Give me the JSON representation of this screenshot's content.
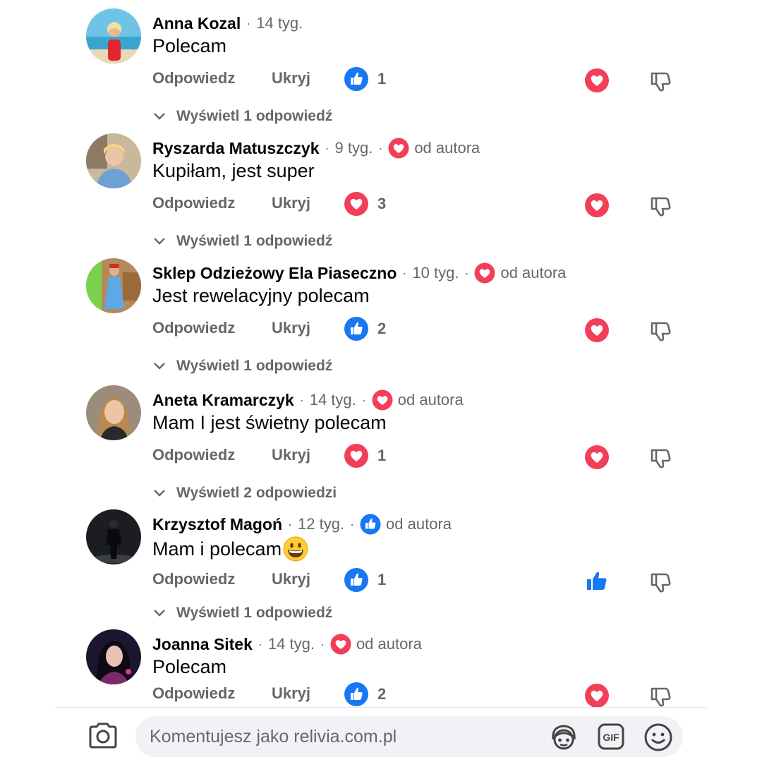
{
  "colors": {
    "like_blue": "#1877f2",
    "love_red": "#f33e58",
    "secondary_text": "#65676b",
    "input_bg": "#f0f2f5"
  },
  "comments": [
    {
      "author": "Anna Kozal",
      "time": "14 tyg.",
      "author_badge": null,
      "text": "Polecam",
      "reply_label": "Odpowiedz",
      "hide_label": "Ukryj",
      "reaction_type": "like",
      "reaction_count": "1",
      "my_reaction": "love",
      "replies_label": "Wyświetl 1 odpowiedź"
    },
    {
      "author": "Ryszarda Matuszczyk",
      "time": "9 tyg.",
      "author_badge": "love",
      "author_badge_label": "od autora",
      "text": "Kupiłam, jest super",
      "reply_label": "Odpowiedz",
      "hide_label": "Ukryj",
      "reaction_type": "love",
      "reaction_count": "3",
      "my_reaction": "love",
      "replies_label": "Wyświetl 1 odpowiedź"
    },
    {
      "author": "Sklep Odzieżowy Ela Piaseczno",
      "time": "10 tyg.",
      "author_badge": "love",
      "author_badge_label": "od autora",
      "text": "Jest rewelacyjny polecam",
      "reply_label": "Odpowiedz",
      "hide_label": "Ukryj",
      "reaction_type": "like",
      "reaction_count": "2",
      "my_reaction": "love",
      "replies_label": "Wyświetl 1 odpowiedź"
    },
    {
      "author": "Aneta Kramarczyk",
      "time": "14 tyg.",
      "author_badge": "love",
      "author_badge_label": "od autora",
      "text": "Mam I jest świetny polecam",
      "reply_label": "Odpowiedz",
      "hide_label": "Ukryj",
      "reaction_type": "love",
      "reaction_count": "1",
      "my_reaction": "love",
      "replies_label": "Wyświetl 2 odpowiedzi"
    },
    {
      "author": "Krzysztof Magoń",
      "time": "12 tyg.",
      "author_badge": "like",
      "author_badge_label": "od autora",
      "text": "Mam i polecam",
      "text_emoji": "grinning-face",
      "reply_label": "Odpowiedz",
      "hide_label": "Ukryj",
      "reaction_type": "like",
      "reaction_count": "1",
      "my_reaction": "like",
      "replies_label": "Wyświetl 1 odpowiedź"
    },
    {
      "author": "Joanna Sitek",
      "time": "14 tyg.",
      "author_badge": "love",
      "author_badge_label": "od autora",
      "text": "Polecam",
      "reply_label": "Odpowiedz",
      "hide_label": "Ukryj",
      "reaction_type": "like",
      "reaction_count": "2",
      "my_reaction": "love",
      "replies_label": null
    }
  ],
  "composer": {
    "placeholder": "Komentujesz jako relivia.com.pl",
    "camera_icon": "camera-icon",
    "avatar_icon": "avatar-sticker-icon",
    "gif_label": "GIF",
    "emoji_icon": "smiley-icon"
  }
}
